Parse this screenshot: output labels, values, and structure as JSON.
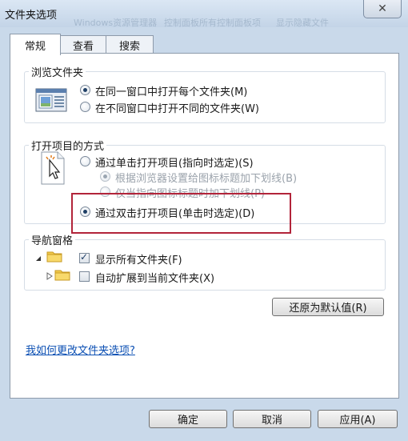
{
  "window": {
    "title": "文件夹选项",
    "close_glyph": "✕",
    "bg_ghost_1": "Windows资源管理器",
    "bg_ghost_2": "控制面板所有控制面板项",
    "bg_ghost_3": "显示隐藏文件"
  },
  "tabs": [
    {
      "label": "常规"
    },
    {
      "label": "查看"
    },
    {
      "label": "搜索"
    }
  ],
  "browse": {
    "title": "浏览文件夹",
    "options": [
      {
        "label": "在同一窗口中打开每个文件夹(M)",
        "selected": true
      },
      {
        "label": "在不同窗口中打开不同的文件夹(W)",
        "selected": false
      }
    ]
  },
  "open": {
    "title": "打开项目的方式",
    "options": [
      {
        "label": "通过单击打开项目(指向时选定)(S)",
        "selected": false
      },
      {
        "label": "根据浏览器设置给图标标题加下划线(B)",
        "selected": true,
        "disabled": true
      },
      {
        "label": "仅当指向图标标题时加下划线(P)",
        "selected": false,
        "disabled": true
      },
      {
        "label": "通过双击打开项目(单击时选定)(D)",
        "selected": true
      }
    ]
  },
  "nav": {
    "title": "导航窗格",
    "options": [
      {
        "label": "显示所有文件夹(F)",
        "checked": true
      },
      {
        "label": "自动扩展到当前文件夹(X)",
        "checked": false
      }
    ]
  },
  "restore_label": "还原为默认值(R)",
  "help_link": "我如何更改文件夹选项?",
  "footer": {
    "ok": "确定",
    "cancel": "取消",
    "apply": "应用(A)"
  },
  "colors": {
    "accent": "#1f3f66",
    "highlight": "#b2243a",
    "link": "#0b4fb3"
  }
}
